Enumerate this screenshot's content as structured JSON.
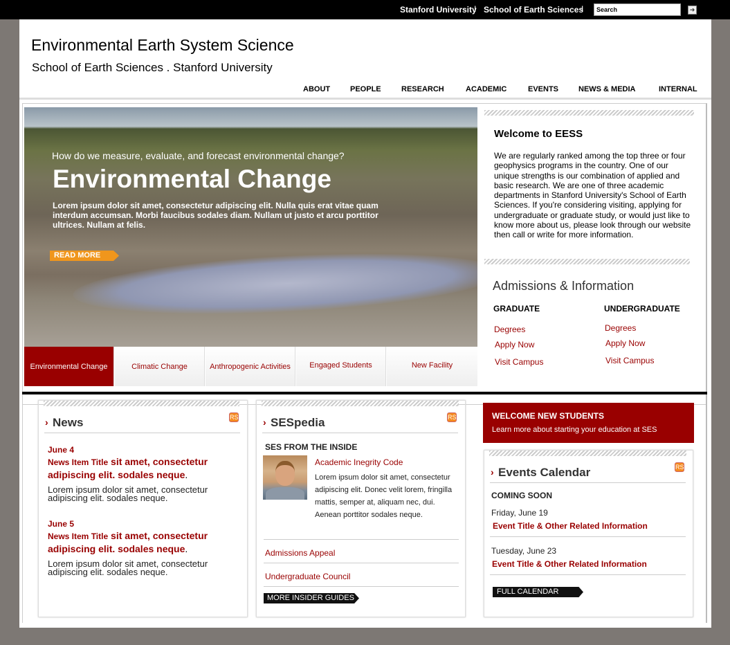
{
  "topbar": {
    "links": [
      "Stanford University",
      "School of Earth Sciences"
    ],
    "separator": "I",
    "search_placeholder": "Search",
    "go_glyph": "➜"
  },
  "header": {
    "title": "Environmental Earth System Science",
    "subtitle": "School of Earth Sciences . Stanford University"
  },
  "nav": [
    "ABOUT",
    "PEOPLE",
    "RESEARCH",
    "ACADEMIC",
    "EVENTS",
    "NEWS & MEDIA",
    "INTERNAL"
  ],
  "hero": {
    "question": "How do we measure, evaluate, and forecast environmental change?",
    "heading": "Environmental Change",
    "body": "Lorem ipsum dolor sit amet, consectetur adipiscing elit. Nulla quis erat vitae quam interdum accumsan. Morbi faucibus sodales diam. Nullam ut justo et arcu porttitor ultrices. Nullam at felis.",
    "read_more": "READ MORE"
  },
  "tabs": [
    "Environmental Change",
    "Climatic Change",
    "Anthropogenic Activities",
    "Engaged Students",
    "New Facility"
  ],
  "welcome": {
    "heading": "Welcome to EESS",
    "body": "We are regularly ranked among the top three or four geophysics programs in the country. One of our unique strengths is our combination of applied and basic research. We are one of three academic departments in Stanford University's School of Earth Sciences. If you're considering visiting, applying for undergraduate or graduate study, or would just like to know more about us, please look through our website then call or write for more information."
  },
  "admissions": {
    "heading": "Admissions & Information",
    "graduate": {
      "label": "GRADUATE",
      "links": [
        "Degrees",
        "Apply Now",
        "Visit Campus"
      ]
    },
    "undergraduate": {
      "label": "UNDERGRADUATE",
      "links": [
        "Degrees",
        "Apply Now",
        "Visit Campus"
      ]
    }
  },
  "news": {
    "heading": "News",
    "arrow": "›",
    "rss": "RSS",
    "items": [
      {
        "date": "June 4",
        "title_small": "News Item Title",
        "title_rest": " sit amet, consectetur adipiscing elit. sodales neque",
        "period": ".",
        "body": "Lorem ipsum dolor sit amet, consectetur adipiscing elit. sodales neque."
      },
      {
        "date": "June 5",
        "title_small": "News Item Title",
        "title_rest": " sit amet, consectetur adipiscing elit. sodales neque",
        "period": ".",
        "body": "Lorem ipsum dolor sit amet, consectetur adipiscing elit. sodales neque."
      }
    ]
  },
  "sespedia": {
    "heading": "SESpedia",
    "subheading": "SES FROM THE INSIDE",
    "feature_link": "Academic Inegrity Code",
    "feature_body": "Lorem ipsum dolor sit amet, consectetur adipiscing elit. Donec velit lorem, fringilla mattis, semper at, aliquam nec, dui. Aenean porttitor sodales neque.",
    "links": [
      "Admissions Appeal",
      "Undergraduate Council"
    ],
    "more_button": "MORE INSIDER GUIDES"
  },
  "new_students": {
    "title": "WELCOME NEW STUDENTS",
    "subtitle": "Learn more about starting your education at SES"
  },
  "events": {
    "heading": "Events Calendar",
    "subheading": "COMING SOON",
    "items": [
      {
        "date": "Friday, June 19",
        "title": "Event Title & Other Related Information"
      },
      {
        "date": "Tuesday, June 23",
        "title": "Event Title & Other Related Information"
      }
    ],
    "full_calendar": "FULL CALENDAR"
  }
}
